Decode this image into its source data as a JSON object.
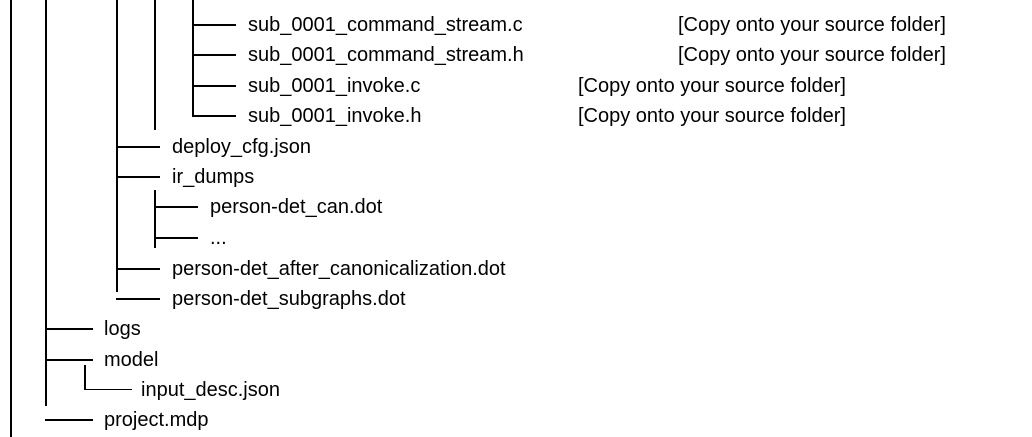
{
  "tree": {
    "entries": [
      {
        "id": "cmd_stream_c",
        "name": "sub_0001_command_stream.c",
        "note": "[Copy onto your source folder]"
      },
      {
        "id": "cmd_stream_h",
        "name": "sub_0001_command_stream.h",
        "note": "[Copy onto your source folder]"
      },
      {
        "id": "invoke_c",
        "name": "sub_0001_invoke.c",
        "note": "[Copy onto your source folder]"
      },
      {
        "id": "invoke_h",
        "name": "sub_0001_invoke.h",
        "note": "[Copy onto your source folder]"
      },
      {
        "id": "deploy_cfg",
        "name": "deploy_cfg.json"
      },
      {
        "id": "ir_dumps",
        "name": "ir_dumps"
      },
      {
        "id": "can_dot",
        "name": "person-det_can.dot"
      },
      {
        "id": "ellipsis",
        "name": "..."
      },
      {
        "id": "after_canon",
        "name": "person-det_after_canonicalization.dot"
      },
      {
        "id": "subgraphs",
        "name": "person-det_subgraphs.dot"
      },
      {
        "id": "logs",
        "name": "logs"
      },
      {
        "id": "model",
        "name": "model"
      },
      {
        "id": "input_desc",
        "name": "input_desc.json"
      },
      {
        "id": "project",
        "name": "project.mdp"
      }
    ]
  }
}
